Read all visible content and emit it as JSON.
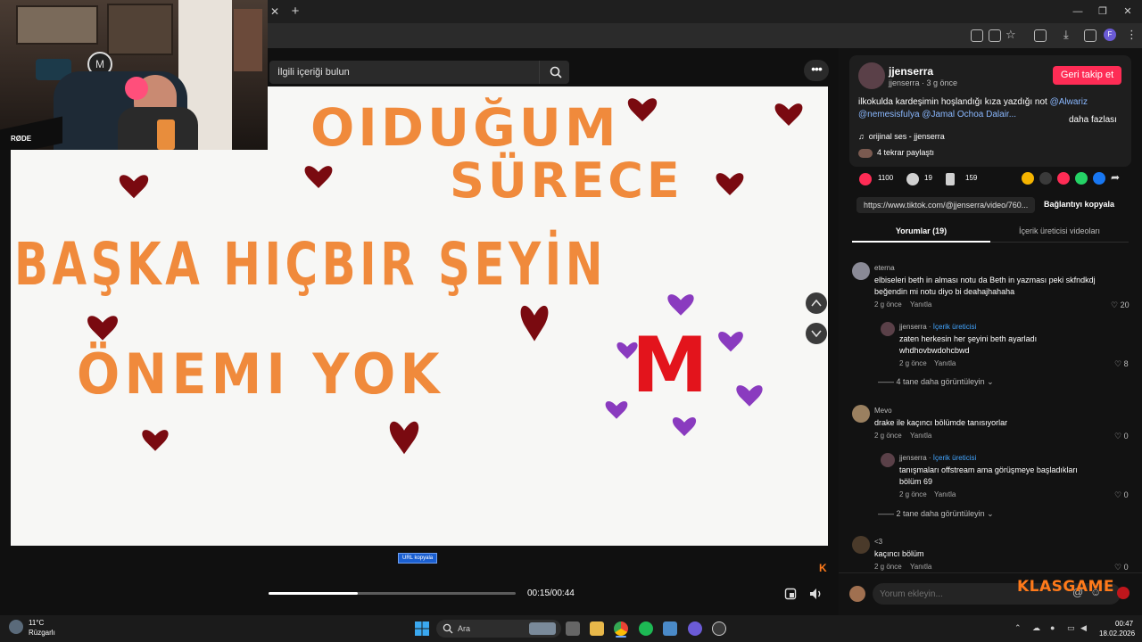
{
  "browser": {
    "close_tab": "✕",
    "new_tab": "+",
    "win_min": "—",
    "win_max": "❐",
    "win_close": "✕",
    "profile_initial": "F"
  },
  "player": {
    "search_placeholder": "İlgili içeriği bulun",
    "more": "•••",
    "time": "00:15/00:44",
    "progress": 0.36,
    "url_tooltip": "URL kopyala"
  },
  "drawing": {
    "line1": "OIDUĞUM",
    "line2": "SÜRECE",
    "line3": "BAŞKA HIÇBIR ŞEYİN",
    "line4": "ÖNEMI YOK",
    "monogram": "M"
  },
  "post": {
    "author": "jjenserra",
    "author_sub": "jjenserra · 3 g önce",
    "follow_label": "Geri takip et",
    "caption_text": "ilkokulda kardeşimin hoşlandığı kıza yazdığı not",
    "caption_mention1": "@Alwariz",
    "caption_mention2": "@nemesisfulya @Jamal Ochoa Dalair...",
    "more_label": "daha fazlası",
    "music": "orijinal ses - jjenserra",
    "reposts": "4 tekrar paylaştı"
  },
  "stats": {
    "likes": "1100",
    "comments": "19",
    "saves": "159"
  },
  "share": {
    "link": "https://www.tiktok.com/@jjenserra/video/760...",
    "copy_label": "Bağlantıyı kopyala"
  },
  "tabs": {
    "comments": "Yorumlar (19)",
    "creator_videos": "İçerik üreticisi videoları"
  },
  "comments": [
    {
      "user": "eterna",
      "text": "elbiseleri beth in alması notu da Beth in yazması peki skfndkdj beğendin mi notu diyo bi deahajhahaha",
      "date": "2 g önce",
      "reply": "Yanıtla",
      "likes": "20",
      "reply_user": "jjenserra",
      "reply_badge": "İçerik üreticisi",
      "reply_text": "zaten herkesin her şeyini beth ayarladı whdhovbwdohcbwd",
      "reply_date": "2 g önce",
      "reply_likes": "8",
      "more": "4 tane daha görüntüleyin"
    },
    {
      "user": "Mevo",
      "text": "drake ile kaçıncı bölümde tanısıyorlar",
      "date": "2 g önce",
      "reply": "Yanıtla",
      "likes": "0",
      "reply_user": "jjenserra",
      "reply_badge": "İçerik üreticisi",
      "reply_text": "tanışmaları offstream ama görüşmeye başladıkları bölüm 69",
      "reply_date": "2 g önce",
      "reply_likes": "0",
      "more": "2 tane daha görüntüleyin"
    },
    {
      "user": "<3",
      "text": "kaçıncı bölüm",
      "date": "2 g önce",
      "reply": "Yanıtla",
      "likes": "0"
    }
  ],
  "comment_input": {
    "placeholder": "Yorum ekleyin..."
  },
  "watermark": "KLASGAME",
  "taskbar": {
    "temp": "11°C",
    "weather": "Rüzgarlı",
    "search": "Ara",
    "time": "00:47",
    "date": "18.02.2026"
  },
  "colors": {
    "accent": "#fe2c55",
    "heart_red": "#7a0a10",
    "heart_purple": "#8a3bbf",
    "marker_orange": "#f08a3c"
  }
}
